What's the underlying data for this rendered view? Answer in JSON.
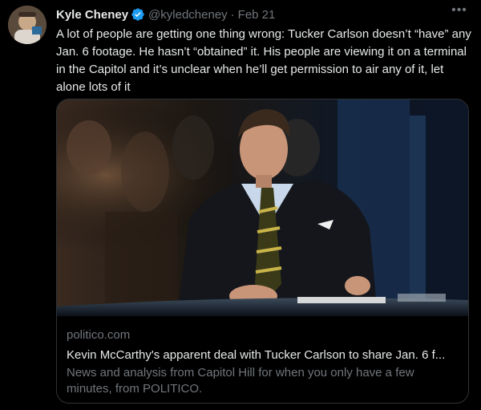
{
  "tweet": {
    "author": {
      "display_name": "Kyle Cheney",
      "handle": "@kyledcheney",
      "verified": true
    },
    "separator": "·",
    "date": "Feb 21",
    "more_icon": "•••",
    "text": "A lot of people are getting one thing wrong: Tucker Carlson doesn’t “have” any Jan. 6 footage. He hasn’t “obtained” it. His people are viewing it on a terminal in the Capitol and it’s unclear when he’ll get permission to air any of it, let alone lots of it"
  },
  "link_card": {
    "domain": "politico.com",
    "title": "Kevin McCarthy's apparent deal with Tucker Carlson to share Jan. 6 f...",
    "description": "News and analysis from Capitol Hill for when you only have a few minutes, from POLITICO."
  },
  "colors": {
    "background": "#000000",
    "text_primary": "#e7e9ea",
    "text_secondary": "#71767b",
    "verified_blue": "#1d9bf0",
    "border": "#2f3336"
  }
}
